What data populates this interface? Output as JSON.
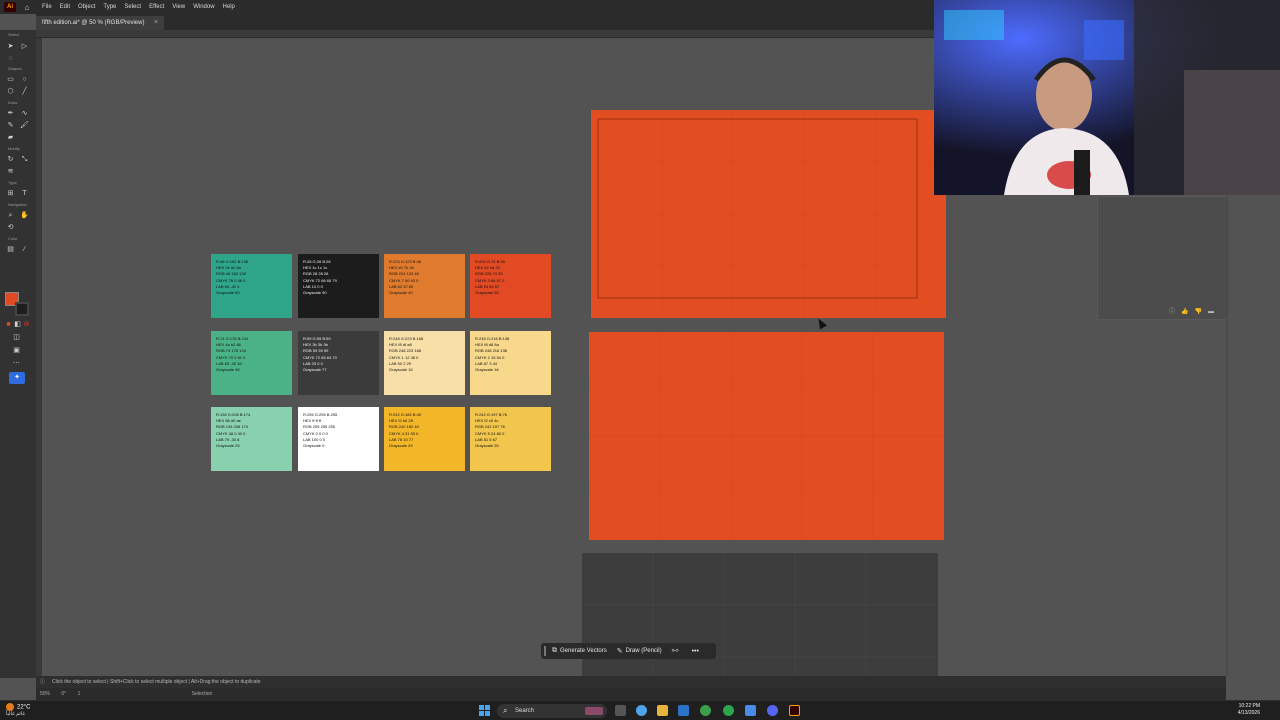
{
  "menubar": {
    "logo": "Ai",
    "items": [
      "File",
      "Edit",
      "Object",
      "Type",
      "Select",
      "Effect",
      "View",
      "Window",
      "Help"
    ]
  },
  "document_tab": {
    "title": "fifth edition.ai* @ 50 % (RGB/Preview)"
  },
  "toolbar": {
    "sections": [
      "Select",
      "Shapes",
      "Draw",
      "Modify",
      "Type",
      "Navigation",
      "Color"
    ]
  },
  "swatches": [
    {
      "bg": "#2fa58a",
      "fg": "#111111",
      "lines": [
        "R:46 G:162 B:138",
        "HEX 2e a2 8a",
        "RGB 46 162 138",
        "CMYK 76 0 46 0",
        "LAB 60 -42 4",
        "Grayscale 50"
      ]
    },
    {
      "bg": "#1c1c1c",
      "fg": "#eeeeee",
      "lines": [
        "R:28 G:28 B:28",
        "HEX 1c 1c 1c",
        "RGB 28 28 28",
        "CMYK 72 66 65 79",
        "LAB 10 0 0",
        "Grayscale 90"
      ]
    },
    {
      "bg": "#e07b2e",
      "fg": "#111111",
      "lines": [
        "R:224 G:123 B:46",
        "HEX e0 7b 2e",
        "RGB 224 123 46",
        "CMYK 7 60 93 0",
        "LAB 62 37 60",
        "Grayscale 40"
      ]
    },
    {
      "bg": "#e24a23",
      "fg": "#111111",
      "lines": [
        "R:226 G:74 B:35",
        "HEX e2 4a 23",
        "RGB 226 74 35",
        "CMYK 3 84 97 0",
        "LAB 54 60 57",
        "Grayscale 55"
      ]
    },
    {
      "bg": "#4ab286",
      "fg": "#111111",
      "lines": [
        "R:74 G:178 B:134",
        "HEX 4a b2 86",
        "RGB 74 178 134",
        "CMYK 70 0 61 0",
        "LAB 65 -45 16",
        "Grayscale 45"
      ]
    },
    {
      "bg": "#3b3b3b",
      "fg": "#eeeeee",
      "lines": [
        "R:59 G:59 B:59",
        "HEX 3b 3b 3b",
        "RGB 59 59 59",
        "CMYK 72 65 64 70",
        "LAB 25 0 0",
        "Grayscale 77"
      ]
    },
    {
      "bg": "#f8dfa8",
      "fg": "#111111",
      "lines": [
        "R:248 G:223 B:168",
        "HEX f8 df a8",
        "RGB 248 223 168",
        "CMYK 1 12 38 0",
        "LAB 90 2 29",
        "Grayscale 16"
      ]
    },
    {
      "bg": "#f8d88a",
      "fg": "#111111",
      "lines": [
        "R:248 G:216 B:138",
        "HEX f8 d8 8a",
        "RGB 248 216 138",
        "CMYK 2 15 54 0",
        "LAB 87 3 44",
        "Grayscale 18"
      ]
    },
    {
      "bg": "#88d0ae",
      "fg": "#111111",
      "lines": [
        "R:136 G:208 B:174",
        "HEX 88 d0 ae",
        "RGB 136 208 174",
        "CMYK 48 0 40 0",
        "LAB 79 -30 8",
        "Grayscale 25"
      ]
    },
    {
      "bg": "#ffffff",
      "fg": "#111111",
      "lines": [
        "R:255 G:255 B:255",
        "HEX ff ff ff",
        "RGB 255 255 255",
        "CMYK 0 0 0 0",
        "LAB 100 0 0",
        "Grayscale 0"
      ]
    },
    {
      "bg": "#f2b628",
      "fg": "#111111",
      "lines": [
        "R:242 G:182 B:40",
        "HEX f2 b6 28",
        "RGB 242 182 40",
        "CMYK 4 31 93 0",
        "LAB 78 10 77",
        "Grayscale 29"
      ]
    },
    {
      "bg": "#f2c54c",
      "fg": "#111111",
      "lines": [
        "R:242 G:197 B:76",
        "HEX f2 c5 4c",
        "RGB 242 197 76",
        "CMYK 5 24 80 0",
        "LAB 81 5 67",
        "Grayscale 25"
      ]
    }
  ],
  "artboards": {
    "orange_color": "#e24e21",
    "dark_color": "#3d3d3d"
  },
  "context_bar": {
    "generate_label": "Generate Vectors",
    "draw_label": "Draw (Pencil)",
    "more_label": "•••"
  },
  "status": {
    "hint": "Click the object to select  |  Shift+Click to select multiple object  |  Alt+Drag the object to duplicate"
  },
  "bottombar": {
    "zoom": "50%",
    "rotation": "0°",
    "artboard_nav": "1",
    "mode": "Selection"
  },
  "taskbar": {
    "temperature": "22°C",
    "weather_text": "غائم غالباً",
    "search_label": "Search",
    "time": "10:22 PM",
    "date": "4/13/2026"
  }
}
